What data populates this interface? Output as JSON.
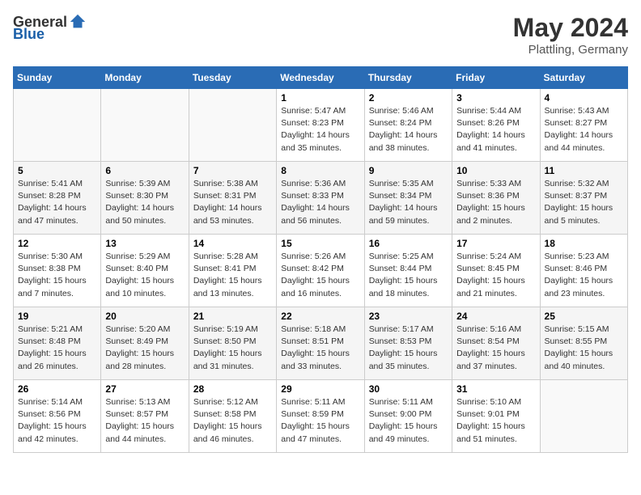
{
  "header": {
    "logo_general": "General",
    "logo_blue": "Blue",
    "month_year": "May 2024",
    "location": "Plattling, Germany"
  },
  "weekdays": [
    "Sunday",
    "Monday",
    "Tuesday",
    "Wednesday",
    "Thursday",
    "Friday",
    "Saturday"
  ],
  "weeks": [
    [
      {
        "day": "",
        "info": ""
      },
      {
        "day": "",
        "info": ""
      },
      {
        "day": "",
        "info": ""
      },
      {
        "day": "1",
        "info": "Sunrise: 5:47 AM\nSunset: 8:23 PM\nDaylight: 14 hours\nand 35 minutes."
      },
      {
        "day": "2",
        "info": "Sunrise: 5:46 AM\nSunset: 8:24 PM\nDaylight: 14 hours\nand 38 minutes."
      },
      {
        "day": "3",
        "info": "Sunrise: 5:44 AM\nSunset: 8:26 PM\nDaylight: 14 hours\nand 41 minutes."
      },
      {
        "day": "4",
        "info": "Sunrise: 5:43 AM\nSunset: 8:27 PM\nDaylight: 14 hours\nand 44 minutes."
      }
    ],
    [
      {
        "day": "5",
        "info": "Sunrise: 5:41 AM\nSunset: 8:28 PM\nDaylight: 14 hours\nand 47 minutes."
      },
      {
        "day": "6",
        "info": "Sunrise: 5:39 AM\nSunset: 8:30 PM\nDaylight: 14 hours\nand 50 minutes."
      },
      {
        "day": "7",
        "info": "Sunrise: 5:38 AM\nSunset: 8:31 PM\nDaylight: 14 hours\nand 53 minutes."
      },
      {
        "day": "8",
        "info": "Sunrise: 5:36 AM\nSunset: 8:33 PM\nDaylight: 14 hours\nand 56 minutes."
      },
      {
        "day": "9",
        "info": "Sunrise: 5:35 AM\nSunset: 8:34 PM\nDaylight: 14 hours\nand 59 minutes."
      },
      {
        "day": "10",
        "info": "Sunrise: 5:33 AM\nSunset: 8:36 PM\nDaylight: 15 hours\nand 2 minutes."
      },
      {
        "day": "11",
        "info": "Sunrise: 5:32 AM\nSunset: 8:37 PM\nDaylight: 15 hours\nand 5 minutes."
      }
    ],
    [
      {
        "day": "12",
        "info": "Sunrise: 5:30 AM\nSunset: 8:38 PM\nDaylight: 15 hours\nand 7 minutes."
      },
      {
        "day": "13",
        "info": "Sunrise: 5:29 AM\nSunset: 8:40 PM\nDaylight: 15 hours\nand 10 minutes."
      },
      {
        "day": "14",
        "info": "Sunrise: 5:28 AM\nSunset: 8:41 PM\nDaylight: 15 hours\nand 13 minutes."
      },
      {
        "day": "15",
        "info": "Sunrise: 5:26 AM\nSunset: 8:42 PM\nDaylight: 15 hours\nand 16 minutes."
      },
      {
        "day": "16",
        "info": "Sunrise: 5:25 AM\nSunset: 8:44 PM\nDaylight: 15 hours\nand 18 minutes."
      },
      {
        "day": "17",
        "info": "Sunrise: 5:24 AM\nSunset: 8:45 PM\nDaylight: 15 hours\nand 21 minutes."
      },
      {
        "day": "18",
        "info": "Sunrise: 5:23 AM\nSunset: 8:46 PM\nDaylight: 15 hours\nand 23 minutes."
      }
    ],
    [
      {
        "day": "19",
        "info": "Sunrise: 5:21 AM\nSunset: 8:48 PM\nDaylight: 15 hours\nand 26 minutes."
      },
      {
        "day": "20",
        "info": "Sunrise: 5:20 AM\nSunset: 8:49 PM\nDaylight: 15 hours\nand 28 minutes."
      },
      {
        "day": "21",
        "info": "Sunrise: 5:19 AM\nSunset: 8:50 PM\nDaylight: 15 hours\nand 31 minutes."
      },
      {
        "day": "22",
        "info": "Sunrise: 5:18 AM\nSunset: 8:51 PM\nDaylight: 15 hours\nand 33 minutes."
      },
      {
        "day": "23",
        "info": "Sunrise: 5:17 AM\nSunset: 8:53 PM\nDaylight: 15 hours\nand 35 minutes."
      },
      {
        "day": "24",
        "info": "Sunrise: 5:16 AM\nSunset: 8:54 PM\nDaylight: 15 hours\nand 37 minutes."
      },
      {
        "day": "25",
        "info": "Sunrise: 5:15 AM\nSunset: 8:55 PM\nDaylight: 15 hours\nand 40 minutes."
      }
    ],
    [
      {
        "day": "26",
        "info": "Sunrise: 5:14 AM\nSunset: 8:56 PM\nDaylight: 15 hours\nand 42 minutes."
      },
      {
        "day": "27",
        "info": "Sunrise: 5:13 AM\nSunset: 8:57 PM\nDaylight: 15 hours\nand 44 minutes."
      },
      {
        "day": "28",
        "info": "Sunrise: 5:12 AM\nSunset: 8:58 PM\nDaylight: 15 hours\nand 46 minutes."
      },
      {
        "day": "29",
        "info": "Sunrise: 5:11 AM\nSunset: 8:59 PM\nDaylight: 15 hours\nand 47 minutes."
      },
      {
        "day": "30",
        "info": "Sunrise: 5:11 AM\nSunset: 9:00 PM\nDaylight: 15 hours\nand 49 minutes."
      },
      {
        "day": "31",
        "info": "Sunrise: 5:10 AM\nSunset: 9:01 PM\nDaylight: 15 hours\nand 51 minutes."
      },
      {
        "day": "",
        "info": ""
      }
    ]
  ]
}
